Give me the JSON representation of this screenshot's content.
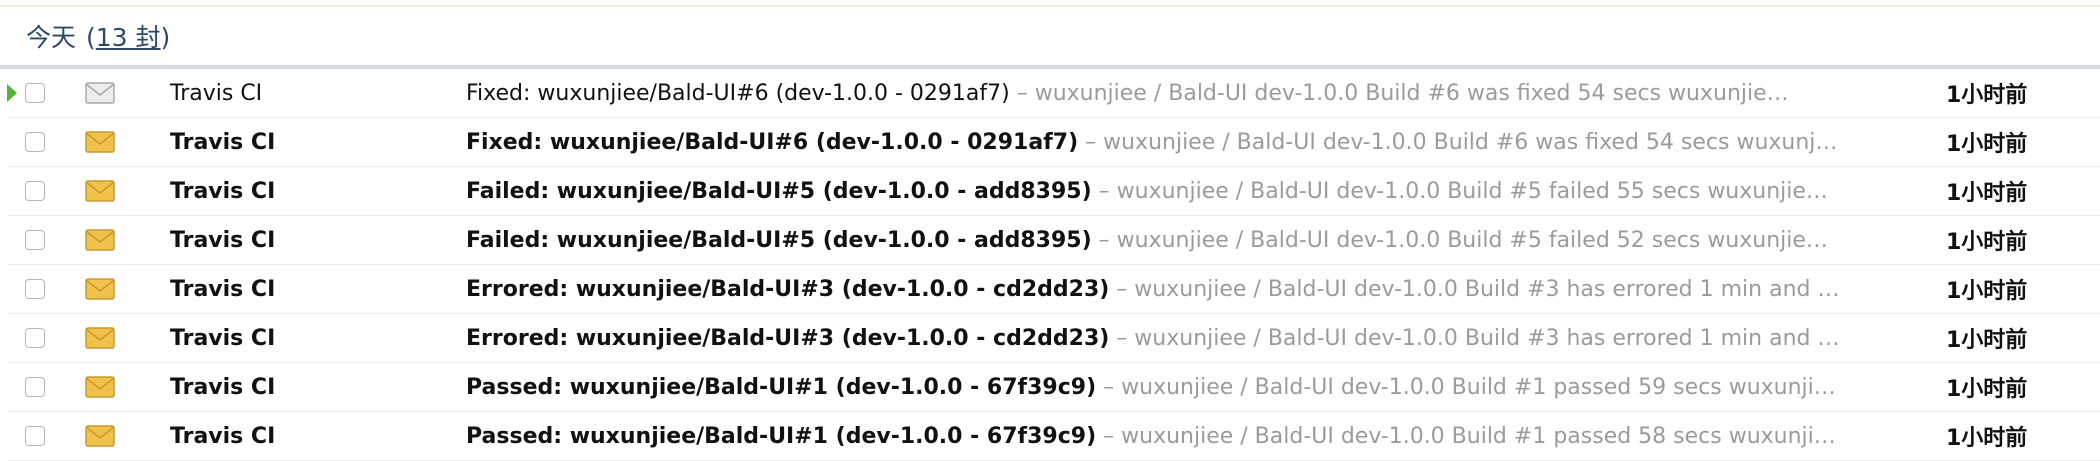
{
  "group": {
    "title": "今天",
    "count_open": "(",
    "count_link": "13 封",
    "count_close": ")"
  },
  "colors": {
    "header_text": "#2e4a6b",
    "preview_text": "#9b9b9b",
    "envelope_unread": "#f0c24b",
    "envelope_read": "#c8c8c8",
    "current_marker": "#55b33b"
  },
  "rows": [
    {
      "sender": "Travis CI",
      "subject": "Fixed: wuxunjiee/Bald-UI#6 (dev-1.0.0 - 0291af7)",
      "preview": " – wuxunjiee / Bald-UI dev-1.0.0 Build #6 was fixed 54 secs wuxunjie…",
      "time": "1小时前",
      "unread": false,
      "current": true,
      "icon": "envelope-open-icon"
    },
    {
      "sender": "Travis CI",
      "subject": "Fixed: wuxunjiee/Bald-UI#6 (dev-1.0.0 - 0291af7)",
      "preview": " – wuxunjiee / Bald-UI dev-1.0.0 Build #6 was fixed 54 secs wuxunj…",
      "time": "1小时前",
      "unread": true,
      "current": false,
      "icon": "envelope-icon"
    },
    {
      "sender": "Travis CI",
      "subject": "Failed: wuxunjiee/Bald-UI#5 (dev-1.0.0 - add8395)",
      "preview": " – wuxunjiee / Bald-UI dev-1.0.0 Build #5 failed 55 secs wuxunjie…",
      "time": "1小时前",
      "unread": true,
      "current": false,
      "icon": "envelope-icon"
    },
    {
      "sender": "Travis CI",
      "subject": "Failed: wuxunjiee/Bald-UI#5 (dev-1.0.0 - add8395)",
      "preview": " – wuxunjiee / Bald-UI dev-1.0.0 Build #5 failed 52 secs wuxunjie…",
      "time": "1小时前",
      "unread": true,
      "current": false,
      "icon": "envelope-icon"
    },
    {
      "sender": "Travis CI",
      "subject": "Errored: wuxunjiee/Bald-UI#3 (dev-1.0.0 - cd2dd23)",
      "preview": " – wuxunjiee / Bald-UI dev-1.0.0 Build #3 has errored 1 min and …",
      "time": "1小时前",
      "unread": true,
      "current": false,
      "icon": "envelope-icon"
    },
    {
      "sender": "Travis CI",
      "subject": "Errored: wuxunjiee/Bald-UI#3 (dev-1.0.0 - cd2dd23)",
      "preview": " – wuxunjiee / Bald-UI dev-1.0.0 Build #3 has errored 1 min and …",
      "time": "1小时前",
      "unread": true,
      "current": false,
      "icon": "envelope-icon"
    },
    {
      "sender": "Travis CI",
      "subject": "Passed: wuxunjiee/Bald-UI#1 (dev-1.0.0 - 67f39c9)",
      "preview": " – wuxunjiee / Bald-UI dev-1.0.0 Build #1 passed 59 secs wuxunji…",
      "time": "1小时前",
      "unread": true,
      "current": false,
      "icon": "envelope-icon"
    },
    {
      "sender": "Travis CI",
      "subject": "Passed: wuxunjiee/Bald-UI#1 (dev-1.0.0 - 67f39c9)",
      "preview": " – wuxunjiee / Bald-UI dev-1.0.0 Build #1 passed 58 secs wuxunji…",
      "time": "1小时前",
      "unread": true,
      "current": false,
      "icon": "envelope-icon"
    }
  ]
}
